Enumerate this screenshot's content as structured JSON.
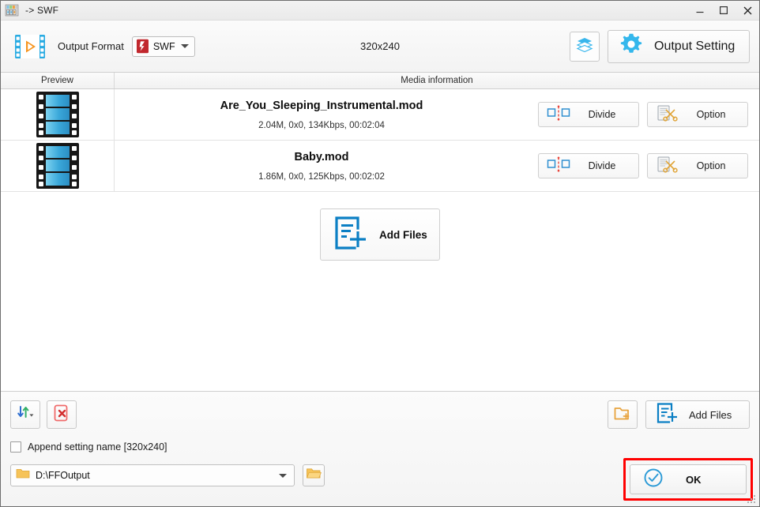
{
  "window": {
    "title": "-> SWF",
    "app_icon": "app-icon",
    "controls": {
      "minimize": "minimize-icon",
      "maximize": "maximize-icon",
      "close": "close-icon"
    }
  },
  "header": {
    "logo_icon": "video-film-icon",
    "output_format_label": "Output Format",
    "format_value": "SWF",
    "format_icon": "swf-file-icon",
    "resolution": "320x240",
    "stack_icon": "layers-icon",
    "output_setting_label": "Output Setting",
    "gear_icon": "gear-icon"
  },
  "columns": {
    "preview": "Preview",
    "media_information": "Media information"
  },
  "files": [
    {
      "thumbnail": "film-strip-thumbnail",
      "name": "Are_You_Sleeping_Instrumental.mod",
      "meta": "2.04M, 0x0, 134Kbps, 00:02:04",
      "divide_label": "Divide",
      "divide_icon": "divide-icon",
      "option_label": "Option",
      "option_icon": "scissors-document-icon"
    },
    {
      "thumbnail": "film-strip-thumbnail",
      "name": "Baby.mod",
      "meta": "1.86M, 0x0, 125Kbps, 00:02:02",
      "divide_label": "Divide",
      "divide_icon": "divide-icon",
      "option_label": "Option",
      "option_icon": "scissors-document-icon"
    }
  ],
  "add_files_center": {
    "label": "Add Files",
    "icon": "add-files-icon"
  },
  "bottom": {
    "sort_icon": "sort-arrows-icon",
    "remove_icon": "remove-file-icon",
    "new_folder_icon": "new-folder-icon",
    "add_files_label": "Add Files",
    "add_files_icon": "add-files-icon",
    "append_checkbox_label": "Append setting name [320x240]",
    "append_checked": false,
    "output_path": "D:\\FFOutput",
    "path_folder_icon": "folder-icon",
    "browse_icon": "folder-open-icon",
    "ok_label": "OK",
    "ok_icon": "check-circle-icon"
  },
  "colors": {
    "accent_blue": "#29ABE2",
    "highlight_red": "#FF0000",
    "folder_yellow": "#F5B942",
    "swf_red": "#C1272D"
  }
}
